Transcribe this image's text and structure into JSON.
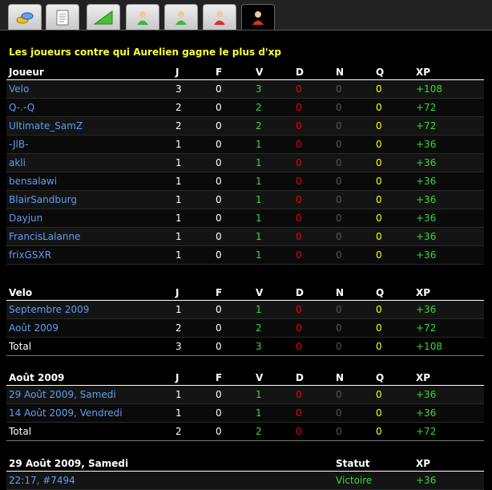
{
  "tabs": [
    {
      "icon": "coins-icon"
    },
    {
      "icon": "document-icon"
    },
    {
      "icon": "chart-icon"
    },
    {
      "icon": "user-green-icon"
    },
    {
      "icon": "user-green2-icon"
    },
    {
      "icon": "user-red-icon"
    },
    {
      "icon": "user-red-active-icon"
    }
  ],
  "section_title": "Les joueurs contre qui Aurelien gagne le plus d'xp",
  "main_table": {
    "headers": [
      "Joueur",
      "J",
      "F",
      "V",
      "D",
      "N",
      "Q",
      "XP"
    ],
    "rows": [
      [
        "Velo",
        "3",
        "0",
        "3",
        "0",
        "0",
        "0",
        "+108"
      ],
      [
        "Q-.-Q",
        "2",
        "0",
        "2",
        "0",
        "0",
        "0",
        "+72"
      ],
      [
        "Ultimate_SamZ",
        "2",
        "0",
        "2",
        "0",
        "0",
        "0",
        "+72"
      ],
      [
        "-JlB-",
        "1",
        "0",
        "1",
        "0",
        "0",
        "0",
        "+36"
      ],
      [
        "akli",
        "1",
        "0",
        "1",
        "0",
        "0",
        "0",
        "+36"
      ],
      [
        "bensalawi",
        "1",
        "0",
        "1",
        "0",
        "0",
        "0",
        "+36"
      ],
      [
        "BlairSandburg",
        "1",
        "0",
        "1",
        "0",
        "0",
        "0",
        "+36"
      ],
      [
        "Dayjun",
        "1",
        "0",
        "1",
        "0",
        "0",
        "0",
        "+36"
      ],
      [
        "FrancisLalanne",
        "1",
        "0",
        "1",
        "0",
        "0",
        "0",
        "+36"
      ],
      [
        "frixGSXR",
        "1",
        "0",
        "1",
        "0",
        "0",
        "0",
        "+36"
      ]
    ]
  },
  "velo_table": {
    "headers": [
      "Velo",
      "J",
      "F",
      "V",
      "D",
      "N",
      "Q",
      "XP"
    ],
    "rows": [
      [
        "Septembre 2009",
        "1",
        "0",
        "1",
        "0",
        "0",
        "0",
        "+36"
      ],
      [
        "Août 2009",
        "2",
        "0",
        "2",
        "0",
        "0",
        "0",
        "+72"
      ]
    ],
    "total": [
      "Total",
      "3",
      "0",
      "3",
      "0",
      "0",
      "0",
      "+108"
    ]
  },
  "month_table": {
    "headers": [
      "Août 2009",
      "J",
      "F",
      "V",
      "D",
      "N",
      "Q",
      "XP"
    ],
    "rows": [
      [
        "29 Août 2009, Samedi",
        "1",
        "0",
        "1",
        "0",
        "0",
        "0",
        "+36"
      ],
      [
        "14 Août 2009, Vendredi",
        "1",
        "0",
        "1",
        "0",
        "0",
        "0",
        "+36"
      ]
    ],
    "total": [
      "Total",
      "2",
      "0",
      "2",
      "0",
      "0",
      "0",
      "+72"
    ]
  },
  "day_table": {
    "headers": [
      "29 Août 2009, Samedi",
      "Statut",
      "XP"
    ],
    "rows": [
      [
        "22:17, #7494",
        "Victoire",
        "+36"
      ]
    ]
  }
}
